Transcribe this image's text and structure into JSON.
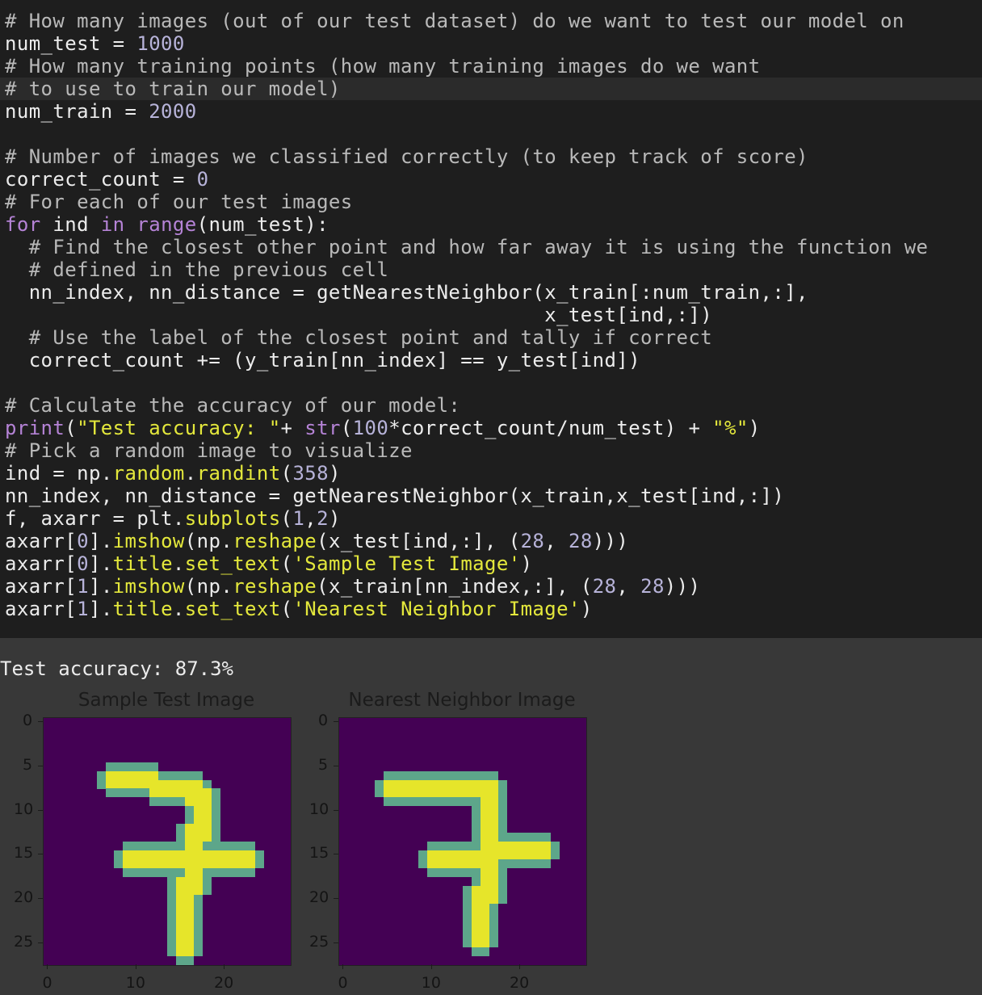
{
  "code": {
    "lines": [
      [
        [
          "comment",
          "# How many images (out of our test dataset) do we want to test our model on"
        ]
      ],
      [
        [
          "plain",
          "num_test = "
        ],
        [
          "num",
          "1000"
        ]
      ],
      [
        [
          "comment",
          "# How many training points (how many training images do we want"
        ]
      ],
      [
        [
          "comment",
          "# to use to train our model)"
        ]
      ],
      [
        [
          "plain",
          "num_train = "
        ],
        [
          "num",
          "2000"
        ]
      ],
      [],
      [
        [
          "comment",
          "# Number of images we classified correctly (to keep track of score)"
        ]
      ],
      [
        [
          "plain",
          "correct_count = "
        ],
        [
          "num",
          "0"
        ]
      ],
      [
        [
          "comment",
          "# For each of our test images"
        ]
      ],
      [
        [
          "kw",
          "for"
        ],
        [
          "plain",
          " ind "
        ],
        [
          "kw",
          "in"
        ],
        [
          "plain",
          " "
        ],
        [
          "kw",
          "range"
        ],
        [
          "plain",
          "(num_test):"
        ]
      ],
      [
        [
          "comment",
          "  # Find the closest other point and how far away it is using the function we"
        ]
      ],
      [
        [
          "comment",
          "  # defined in the previous cell"
        ]
      ],
      [
        [
          "plain",
          "  nn_index, nn_distance = getNearestNeighbor(x_train[:num_train,:],"
        ]
      ],
      [
        [
          "plain",
          "                                             x_test[ind,:])"
        ]
      ],
      [
        [
          "comment",
          "  # Use the label of the closest point and tally if correct"
        ]
      ],
      [
        [
          "plain",
          "  correct_count += (y_train[nn_index] == y_test[ind])"
        ]
      ],
      [],
      [
        [
          "comment",
          "# Calculate the accuracy of our model:"
        ]
      ],
      [
        [
          "kw",
          "print"
        ],
        [
          "plain",
          "("
        ],
        [
          "str",
          "\"Test accuracy: \""
        ],
        [
          "plain",
          "+ "
        ],
        [
          "kw",
          "str"
        ],
        [
          "plain",
          "("
        ],
        [
          "num",
          "100"
        ],
        [
          "plain",
          "*correct_count/num_test) + "
        ],
        [
          "str",
          "\"%\""
        ],
        [
          "plain",
          ")"
        ]
      ],
      [
        [
          "comment",
          "# Pick a random image to visualize"
        ]
      ],
      [
        [
          "plain",
          "ind = np."
        ],
        [
          "attr",
          "random"
        ],
        [
          "plain",
          "."
        ],
        [
          "attr",
          "randint"
        ],
        [
          "plain",
          "("
        ],
        [
          "num",
          "358"
        ],
        [
          "plain",
          ")"
        ]
      ],
      [
        [
          "plain",
          "nn_index, nn_distance = getNearestNeighbor(x_train,x_test[ind,:])"
        ]
      ],
      [
        [
          "plain",
          "f, axarr = plt."
        ],
        [
          "attr",
          "subplots"
        ],
        [
          "plain",
          "("
        ],
        [
          "num",
          "1"
        ],
        [
          "plain",
          ","
        ],
        [
          "num",
          "2"
        ],
        [
          "plain",
          ")"
        ]
      ],
      [
        [
          "plain",
          "axarr["
        ],
        [
          "num",
          "0"
        ],
        [
          "plain",
          "]."
        ],
        [
          "attr",
          "imshow"
        ],
        [
          "plain",
          "(np."
        ],
        [
          "attr",
          "reshape"
        ],
        [
          "plain",
          "(x_test[ind,:], ("
        ],
        [
          "num",
          "28"
        ],
        [
          "plain",
          ", "
        ],
        [
          "num",
          "28"
        ],
        [
          "plain",
          ")))"
        ]
      ],
      [
        [
          "plain",
          "axarr["
        ],
        [
          "num",
          "0"
        ],
        [
          "plain",
          "]."
        ],
        [
          "attr",
          "title"
        ],
        [
          "plain",
          "."
        ],
        [
          "attr",
          "set_text"
        ],
        [
          "plain",
          "("
        ],
        [
          "str",
          "'Sample Test Image'"
        ],
        [
          "plain",
          ")"
        ]
      ],
      [
        [
          "plain",
          "axarr["
        ],
        [
          "num",
          "1"
        ],
        [
          "plain",
          "]."
        ],
        [
          "attr",
          "imshow"
        ],
        [
          "plain",
          "(np."
        ],
        [
          "attr",
          "reshape"
        ],
        [
          "plain",
          "(x_train[nn_index,:], ("
        ],
        [
          "num",
          "28"
        ],
        [
          "plain",
          ", "
        ],
        [
          "num",
          "28"
        ],
        [
          "plain",
          ")))"
        ]
      ],
      [
        [
          "plain",
          "axarr["
        ],
        [
          "num",
          "1"
        ],
        [
          "plain",
          "]."
        ],
        [
          "attr",
          "title"
        ],
        [
          "plain",
          "."
        ],
        [
          "attr",
          "set_text"
        ],
        [
          "plain",
          "("
        ],
        [
          "str",
          "'Nearest Neighbor Image'"
        ],
        [
          "plain",
          ")"
        ]
      ]
    ]
  },
  "output": {
    "text": "Test accuracy: 87.3%"
  },
  "figure": {
    "axes": [
      {
        "title": "Sample Test Image",
        "yticks": [
          "0",
          "5",
          "10",
          "15",
          "20",
          "25"
        ],
        "xticks": [
          "0",
          "10",
          "20"
        ]
      },
      {
        "title": "Nearest Neighbor Image",
        "yticks": [
          "0",
          "5",
          "10",
          "15",
          "20",
          "25"
        ],
        "xticks": [
          "0",
          "10",
          "20"
        ]
      }
    ],
    "colors": {
      "low": "#440154",
      "mid": "#5da68a",
      "high": "#e6e52a"
    }
  }
}
